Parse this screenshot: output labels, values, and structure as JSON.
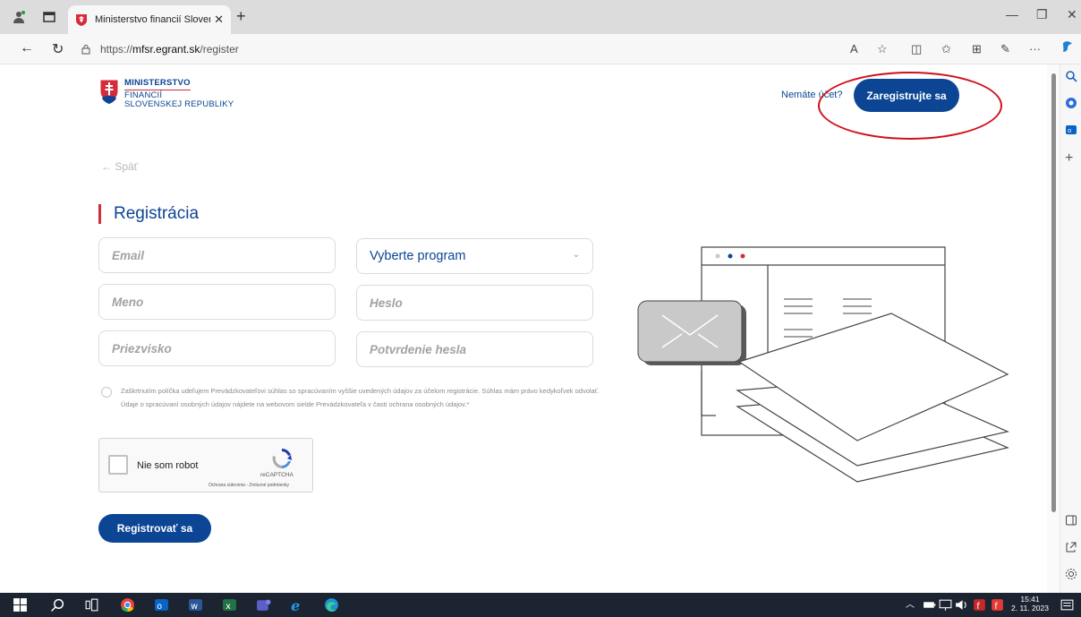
{
  "browser": {
    "tab_title": "Ministerstvo financií Slovenskej r",
    "url_prefix": "https://",
    "url_host": "mfsr.egrant.sk",
    "url_path": "/register"
  },
  "header": {
    "logo_line1": "MINISTERSTVO",
    "logo_line2": "FINANCIÍ",
    "logo_line3": "SLOVENSKEJ REPUBLIKY",
    "no_account_text": "Nemáte účet?",
    "register_button": "Zaregistrujte sa"
  },
  "form": {
    "back_label": "← Späť",
    "title": "Registrácia",
    "email_placeholder": "Email",
    "program_select": "Vyberte program",
    "name_placeholder": "Meno",
    "password_placeholder": "Heslo",
    "surname_placeholder": "Priezvisko",
    "password_confirm_placeholder": "Potvrdenie hesla",
    "consent_text": "Zaškrtnutím políčka udeľujem Prevádzkovateľovi súhlas so spracúvaním vyššie uvedených údajov za účelom registrácie. Súhlas mám právo kedykoľvek odvolať. Údaje o spracúvaní osobných údajov nájdete na webovom sielde Prevádzkovateľa v časti ochrana osobných údajov.*",
    "captcha_label": "Nie som robot",
    "captcha_brand": "reCAPTCHA",
    "captcha_terms": "Ochrana súkromia - Zmluvné podmienky",
    "submit_label": "Registrovať sa"
  },
  "taskbar": {
    "time": "15:41",
    "date": "2. 11. 2023"
  },
  "colors": {
    "brand_blue": "#0b4594",
    "accent_red": "#d42c3a",
    "annotation_red": "#d0101a"
  }
}
